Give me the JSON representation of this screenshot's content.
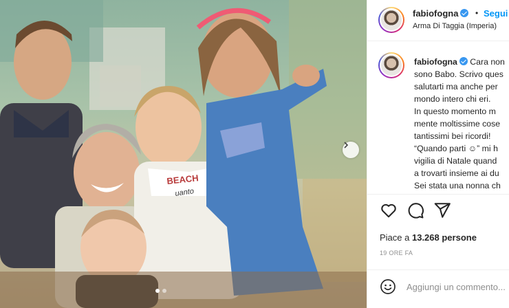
{
  "post": {
    "username": "fabiofogna",
    "follow_label": "Segui",
    "separator": "•",
    "location": "Arma Di Taggia (Imperia)"
  },
  "caption": {
    "username": "fabiofogna",
    "lines": [
      "Cara non",
      "sono Babo. Scrivo ques",
      "salutarti ma anche per",
      "mondo intero chi eri.",
      "In questo momento m",
      "mente moltissime cose",
      "tantissimi bei ricordi!",
      "“Quando parti ☺” mi h",
      "vigilia di Natale quand",
      "a trovarti insieme ai du",
      "Sei stata una nonna ch"
    ]
  },
  "photo": {
    "banner_text_1": "BEACH",
    "banner_text_2": "uanto",
    "carousel": {
      "count": 2,
      "active": 0
    }
  },
  "engagement": {
    "likes_prefix": "Piace a ",
    "likes_count": "13.268",
    "likes_suffix": " persone",
    "time_ago": "19 ORE FA"
  },
  "comment": {
    "placeholder": "Aggiungi un commento..."
  },
  "icons": {
    "like": "heart-icon",
    "comment": "comment-icon",
    "share": "share-icon",
    "emoji": "emoji-icon",
    "next": "chevron-right-icon"
  },
  "colors": {
    "accent": "#0095f6",
    "verified": "#3897f0",
    "text": "#262626",
    "muted": "#8e8e8e"
  }
}
